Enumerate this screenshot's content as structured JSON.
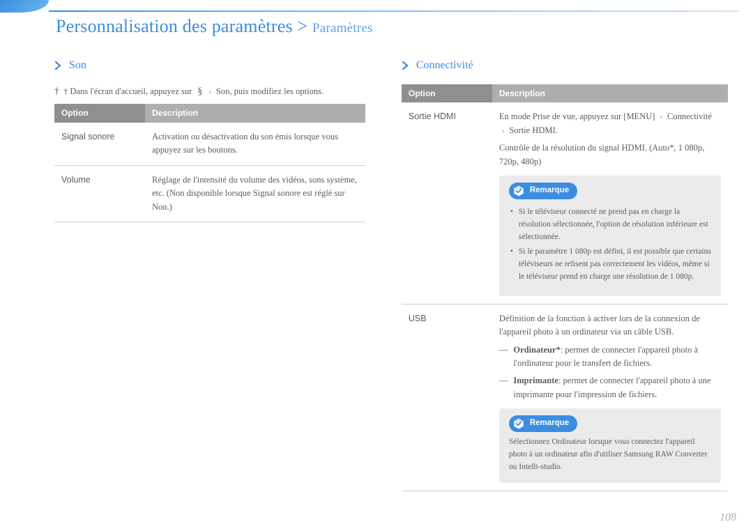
{
  "breadcrumb": {
    "main": "Personnalisation des paramètres",
    "sep": " > ",
    "sub": "Paramètres"
  },
  "left": {
    "title": "Son",
    "intro_lead": "† Dans l'écran d'accueil, appuyez sur",
    "intro_mid": "§",
    "intro_after": "Son, puis modifiez les options.",
    "table": {
      "head_opt": "Option",
      "head_desc": "Description",
      "rows": [
        {
          "opt": "Signal sonore",
          "desc": "Activation ou désactivation du son émis lorsque vous appuyez sur les boutons."
        },
        {
          "opt": "Volume",
          "desc": "Réglage de l'intensité du volume des vidéos, sons système, etc. (Non disponible lorsque Signal sonore est réglé sur Non.)"
        }
      ]
    }
  },
  "right": {
    "title": "Connectivité",
    "table": {
      "head_opt": "Option",
      "head_desc": "Description",
      "rows": [
        {
          "opt": "Sortie HDMI",
          "desc_line1": "En mode Prise de vue, appuyez sur [MENU]",
          "desc_line2": "Connectivité",
          "desc_line3": "Sortie HDMI.",
          "desc_after": "Contrôle de la résolution du signal HDMI. (Auto*, 1 080p, 720p, 480p)"
        },
        {
          "opt": "",
          "desc": "",
          "note_label": "Remarque",
          "notes": [
            "Si le téléviseur connecté ne prend pas en charge la résolution sélectionnée, l'option de résolution inférieure est sélectionnée.",
            "Si le paramètre 1 080p est défini, il est possible que certains téléviseurs ne relisent pas correctement les vidéos, même si le téléviseur prend en charge une résolution de 1 080p."
          ]
        },
        {
          "opt": "USB",
          "desc": "Définition de la fonction à activer lors de la connexion de l'appareil photo à un ordinateur via un câble USB.",
          "bullets": [
            {
              "label": "Ordinateur*",
              "text": ": permet de connecter l'appareil photo à l'ordinateur pour le transfert de fichiers."
            },
            {
              "label": "Imprimante",
              "text": ": permet de connecter l'appareil photo à une imprimante pour l'impression de fichiers."
            }
          ],
          "note_label": "Remarque",
          "note_text": "Sélectionnez Ordinateur lorsque vous connectez l'appareil photo à un ordinateur afin d'utiliser Samsung RAW Converter ou Intelli-studio."
        }
      ]
    }
  },
  "page_number": "108"
}
